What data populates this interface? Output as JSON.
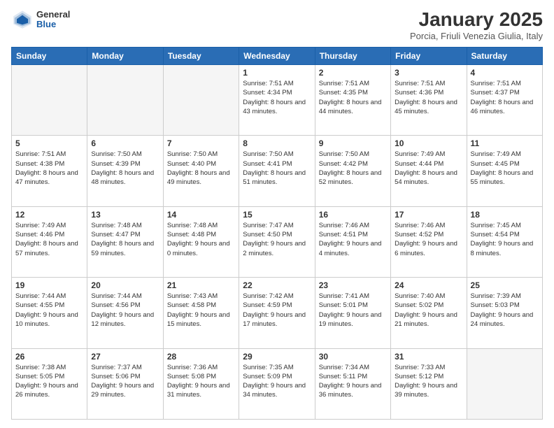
{
  "header": {
    "logo_general": "General",
    "logo_blue": "Blue",
    "month_title": "January 2025",
    "subtitle": "Porcia, Friuli Venezia Giulia, Italy"
  },
  "weekdays": [
    "Sunday",
    "Monday",
    "Tuesday",
    "Wednesday",
    "Thursday",
    "Friday",
    "Saturday"
  ],
  "weeks": [
    [
      {
        "day": "",
        "info": ""
      },
      {
        "day": "",
        "info": ""
      },
      {
        "day": "",
        "info": ""
      },
      {
        "day": "1",
        "info": "Sunrise: 7:51 AM\nSunset: 4:34 PM\nDaylight: 8 hours and 43 minutes."
      },
      {
        "day": "2",
        "info": "Sunrise: 7:51 AM\nSunset: 4:35 PM\nDaylight: 8 hours and 44 minutes."
      },
      {
        "day": "3",
        "info": "Sunrise: 7:51 AM\nSunset: 4:36 PM\nDaylight: 8 hours and 45 minutes."
      },
      {
        "day": "4",
        "info": "Sunrise: 7:51 AM\nSunset: 4:37 PM\nDaylight: 8 hours and 46 minutes."
      }
    ],
    [
      {
        "day": "5",
        "info": "Sunrise: 7:51 AM\nSunset: 4:38 PM\nDaylight: 8 hours and 47 minutes."
      },
      {
        "day": "6",
        "info": "Sunrise: 7:50 AM\nSunset: 4:39 PM\nDaylight: 8 hours and 48 minutes."
      },
      {
        "day": "7",
        "info": "Sunrise: 7:50 AM\nSunset: 4:40 PM\nDaylight: 8 hours and 49 minutes."
      },
      {
        "day": "8",
        "info": "Sunrise: 7:50 AM\nSunset: 4:41 PM\nDaylight: 8 hours and 51 minutes."
      },
      {
        "day": "9",
        "info": "Sunrise: 7:50 AM\nSunset: 4:42 PM\nDaylight: 8 hours and 52 minutes."
      },
      {
        "day": "10",
        "info": "Sunrise: 7:49 AM\nSunset: 4:44 PM\nDaylight: 8 hours and 54 minutes."
      },
      {
        "day": "11",
        "info": "Sunrise: 7:49 AM\nSunset: 4:45 PM\nDaylight: 8 hours and 55 minutes."
      }
    ],
    [
      {
        "day": "12",
        "info": "Sunrise: 7:49 AM\nSunset: 4:46 PM\nDaylight: 8 hours and 57 minutes."
      },
      {
        "day": "13",
        "info": "Sunrise: 7:48 AM\nSunset: 4:47 PM\nDaylight: 8 hours and 59 minutes."
      },
      {
        "day": "14",
        "info": "Sunrise: 7:48 AM\nSunset: 4:48 PM\nDaylight: 9 hours and 0 minutes."
      },
      {
        "day": "15",
        "info": "Sunrise: 7:47 AM\nSunset: 4:50 PM\nDaylight: 9 hours and 2 minutes."
      },
      {
        "day": "16",
        "info": "Sunrise: 7:46 AM\nSunset: 4:51 PM\nDaylight: 9 hours and 4 minutes."
      },
      {
        "day": "17",
        "info": "Sunrise: 7:46 AM\nSunset: 4:52 PM\nDaylight: 9 hours and 6 minutes."
      },
      {
        "day": "18",
        "info": "Sunrise: 7:45 AM\nSunset: 4:54 PM\nDaylight: 9 hours and 8 minutes."
      }
    ],
    [
      {
        "day": "19",
        "info": "Sunrise: 7:44 AM\nSunset: 4:55 PM\nDaylight: 9 hours and 10 minutes."
      },
      {
        "day": "20",
        "info": "Sunrise: 7:44 AM\nSunset: 4:56 PM\nDaylight: 9 hours and 12 minutes."
      },
      {
        "day": "21",
        "info": "Sunrise: 7:43 AM\nSunset: 4:58 PM\nDaylight: 9 hours and 15 minutes."
      },
      {
        "day": "22",
        "info": "Sunrise: 7:42 AM\nSunset: 4:59 PM\nDaylight: 9 hours and 17 minutes."
      },
      {
        "day": "23",
        "info": "Sunrise: 7:41 AM\nSunset: 5:01 PM\nDaylight: 9 hours and 19 minutes."
      },
      {
        "day": "24",
        "info": "Sunrise: 7:40 AM\nSunset: 5:02 PM\nDaylight: 9 hours and 21 minutes."
      },
      {
        "day": "25",
        "info": "Sunrise: 7:39 AM\nSunset: 5:03 PM\nDaylight: 9 hours and 24 minutes."
      }
    ],
    [
      {
        "day": "26",
        "info": "Sunrise: 7:38 AM\nSunset: 5:05 PM\nDaylight: 9 hours and 26 minutes."
      },
      {
        "day": "27",
        "info": "Sunrise: 7:37 AM\nSunset: 5:06 PM\nDaylight: 9 hours and 29 minutes."
      },
      {
        "day": "28",
        "info": "Sunrise: 7:36 AM\nSunset: 5:08 PM\nDaylight: 9 hours and 31 minutes."
      },
      {
        "day": "29",
        "info": "Sunrise: 7:35 AM\nSunset: 5:09 PM\nDaylight: 9 hours and 34 minutes."
      },
      {
        "day": "30",
        "info": "Sunrise: 7:34 AM\nSunset: 5:11 PM\nDaylight: 9 hours and 36 minutes."
      },
      {
        "day": "31",
        "info": "Sunrise: 7:33 AM\nSunset: 5:12 PM\nDaylight: 9 hours and 39 minutes."
      },
      {
        "day": "",
        "info": ""
      }
    ]
  ]
}
